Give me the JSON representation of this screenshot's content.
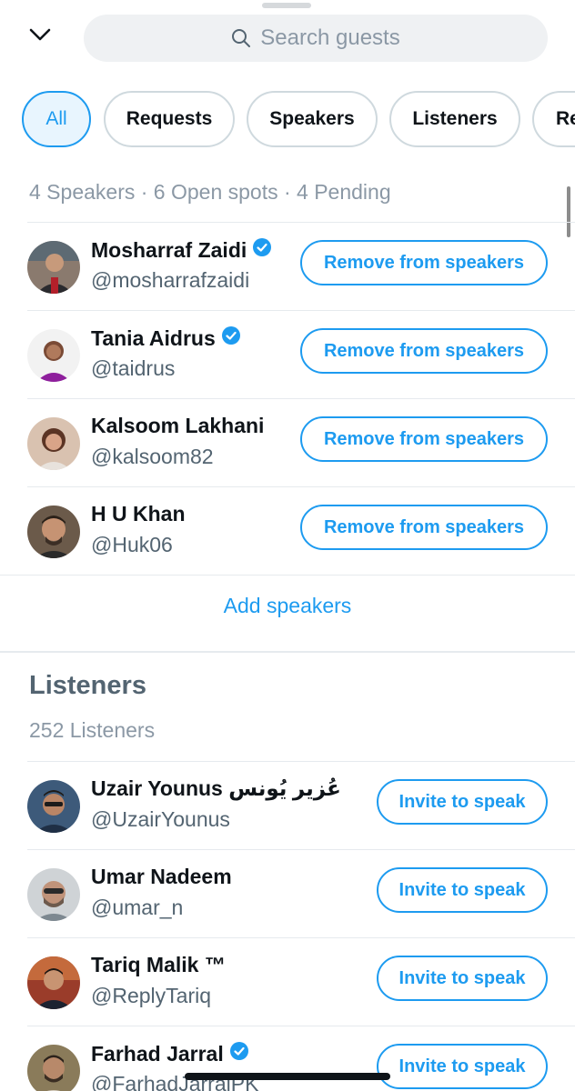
{
  "search": {
    "placeholder": "Search guests"
  },
  "filters": [
    "All",
    "Requests",
    "Speakers",
    "Listeners",
    "Re"
  ],
  "summary": "4 Speakers · 6 Open spots · 4 Pending",
  "speakers": [
    {
      "name": "Mosharraf Zaidi",
      "handle": "@mosharrafzaidi",
      "verified": true,
      "action": "Remove from speakers"
    },
    {
      "name": "Tania Aidrus",
      "handle": "@taidrus",
      "verified": true,
      "action": "Remove from speakers"
    },
    {
      "name": "Kalsoom Lakhani",
      "handle": "@kalsoom82",
      "verified": false,
      "action": "Remove from speakers"
    },
    {
      "name": "H U Khan",
      "handle": "@Huk06",
      "verified": false,
      "action": "Remove from speakers"
    }
  ],
  "add_speakers": "Add speakers",
  "listeners_section": {
    "title": "Listeners",
    "count": "252 Listeners"
  },
  "listeners": [
    {
      "name": "Uzair Younus عُزیر یُونس",
      "handle": "@UzairYounus",
      "verified": false,
      "action": "Invite to speak"
    },
    {
      "name": "Umar Nadeem",
      "handle": "@umar_n",
      "verified": false,
      "action": "Invite to speak"
    },
    {
      "name": "Tariq Malik ™",
      "handle": "@ReplyTariq",
      "verified": false,
      "action": "Invite to speak"
    },
    {
      "name": "Farhad Jarral",
      "handle": "@FarhadJarralPK",
      "verified": true,
      "action": "Invite to speak"
    }
  ],
  "colors": {
    "accent": "#1d9bf0",
    "secondary_text": "#536471",
    "muted_text": "#8b98a5",
    "divider": "#e6eaee"
  },
  "icons": {
    "collapse": "chevron-down-icon",
    "search": "search-icon",
    "verified": "verified-badge-icon"
  }
}
